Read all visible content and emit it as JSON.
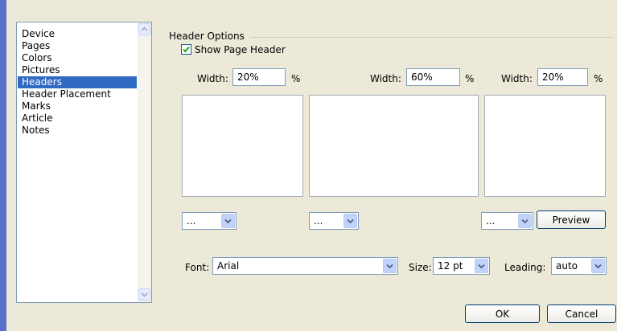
{
  "sidebar": {
    "items": [
      {
        "label": "Device",
        "selected": false
      },
      {
        "label": "Pages",
        "selected": false
      },
      {
        "label": "Colors",
        "selected": false
      },
      {
        "label": "Pictures",
        "selected": false
      },
      {
        "label": "Headers",
        "selected": true
      },
      {
        "label": "Header Placement",
        "selected": false
      },
      {
        "label": "Marks",
        "selected": false
      },
      {
        "label": "Article",
        "selected": false
      },
      {
        "label": "Notes",
        "selected": false
      }
    ]
  },
  "header_options": {
    "group_title": "Header Options",
    "show_page_header": {
      "label": "Show Page Header",
      "checked": true
    },
    "width_label": "Width:",
    "percent_sign": "%",
    "columns": [
      {
        "width": "20%",
        "combo_value": "..."
      },
      {
        "width": "60%",
        "combo_value": "..."
      },
      {
        "width": "20%",
        "combo_value": "..."
      }
    ],
    "preview_label": "Preview"
  },
  "font_row": {
    "font_label": "Font:",
    "font_value": "Arial",
    "size_label": "Size:",
    "size_value": "12 pt",
    "leading_label": "Leading:",
    "leading_value": "auto"
  },
  "buttons": {
    "ok_label": "OK",
    "cancel_label": "Cancel"
  },
  "colors": {
    "selection": "#316ac5",
    "accent_bar": "#5b6fc9",
    "dialog_bg": "#ece9d8"
  }
}
